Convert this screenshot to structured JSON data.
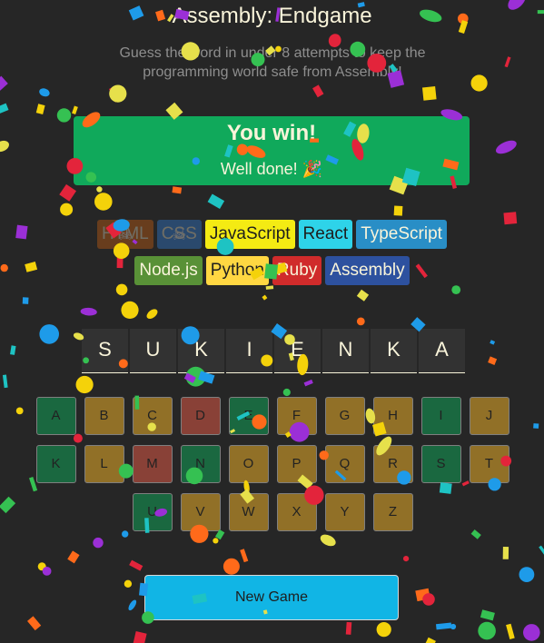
{
  "header": {
    "title": "Assembly: Endgame",
    "subtitle": "Guess the word in under 8 attempts to keep the programming world safe from Assembly!"
  },
  "status": {
    "title": "You win!",
    "message": "Well done! 🎉",
    "color": "#10a95b"
  },
  "languages": [
    {
      "name": "HTML",
      "bg": "#e2680f",
      "fg": "#f9f4da",
      "lost": true
    },
    {
      "name": "CSS",
      "bg": "#328af1",
      "fg": "#f9f4da",
      "lost": true
    },
    {
      "name": "JavaScript",
      "bg": "#f4eb13",
      "fg": "#1e1e1e",
      "lost": false
    },
    {
      "name": "React",
      "bg": "#2ed3e9",
      "fg": "#1e1e1e",
      "lost": false
    },
    {
      "name": "TypeScript",
      "bg": "#298ec6",
      "fg": "#f9f4da",
      "lost": false
    },
    {
      "name": "Node.js",
      "bg": "#599137",
      "fg": "#f9f4da",
      "lost": false
    },
    {
      "name": "Python",
      "bg": "#ffd742",
      "fg": "#1e1e1e",
      "lost": false
    },
    {
      "name": "Ruby",
      "bg": "#d02b2b",
      "fg": "#f9f4da",
      "lost": false
    },
    {
      "name": "Assembly",
      "bg": "#2d519f",
      "fg": "#f9f4da",
      "lost": false
    }
  ],
  "lost_icon": "skull-icon",
  "word": [
    "S",
    "U",
    "K",
    "I",
    "E",
    "N",
    "K",
    "A"
  ],
  "keyboard": [
    [
      {
        "l": "A",
        "s": "ok"
      },
      {
        "l": "B",
        "s": "def"
      },
      {
        "l": "C",
        "s": "def"
      },
      {
        "l": "D",
        "s": "bad"
      },
      {
        "l": "E",
        "s": "ok"
      },
      {
        "l": "F",
        "s": "def"
      },
      {
        "l": "G",
        "s": "def"
      },
      {
        "l": "H",
        "s": "def"
      },
      {
        "l": "I",
        "s": "ok"
      },
      {
        "l": "J",
        "s": "def"
      }
    ],
    [
      {
        "l": "K",
        "s": "ok"
      },
      {
        "l": "L",
        "s": "def"
      },
      {
        "l": "M",
        "s": "bad"
      },
      {
        "l": "N",
        "s": "ok"
      },
      {
        "l": "O",
        "s": "def"
      },
      {
        "l": "P",
        "s": "def"
      },
      {
        "l": "Q",
        "s": "def"
      },
      {
        "l": "R",
        "s": "def"
      },
      {
        "l": "S",
        "s": "ok"
      },
      {
        "l": "T",
        "s": "def"
      }
    ],
    [
      {
        "l": "U",
        "s": "ok"
      },
      {
        "l": "V",
        "s": "def"
      },
      {
        "l": "W",
        "s": "def"
      },
      {
        "l": "X",
        "s": "def"
      },
      {
        "l": "Y",
        "s": "def"
      },
      {
        "l": "Z",
        "s": "def"
      }
    ]
  ],
  "new_game_label": "New Game",
  "confetti_colors": [
    "#f4d20a",
    "#1e9be9",
    "#9b2fd6",
    "#35c152",
    "#ff6a1a",
    "#e3243b",
    "#1ec3c3",
    "#e6e04b"
  ]
}
